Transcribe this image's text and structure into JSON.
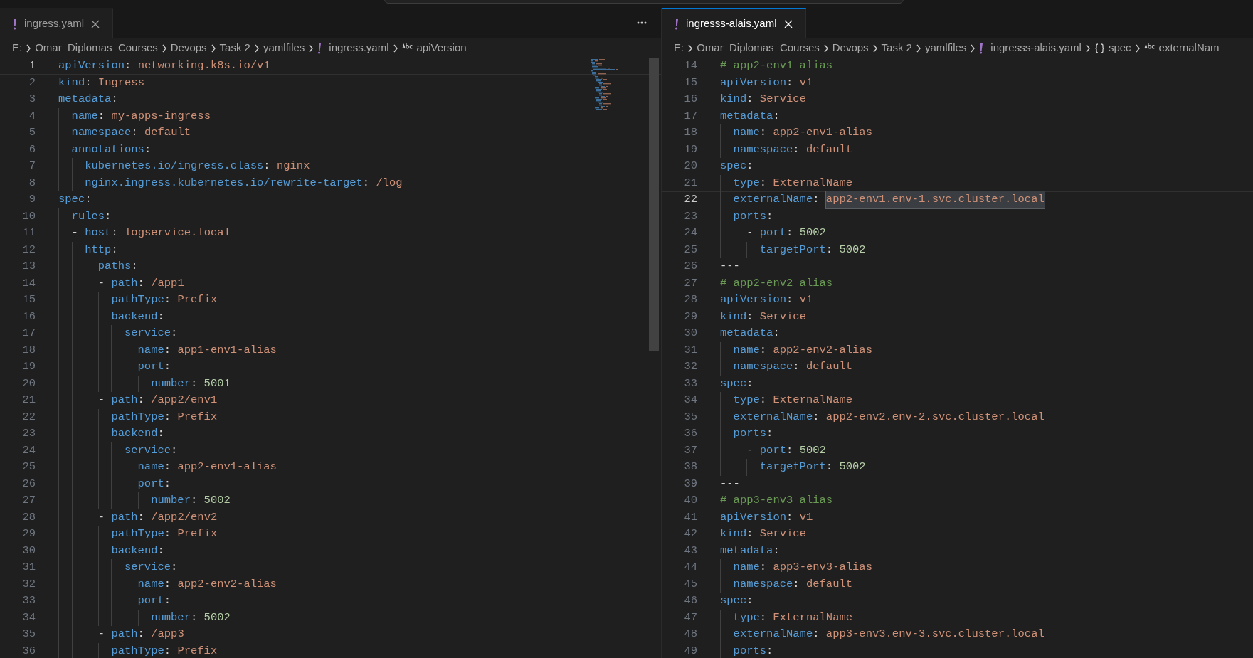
{
  "panes": [
    {
      "tabs": [
        {
          "label": "ingress.yaml",
          "selected": true
        }
      ],
      "group_active": false,
      "more_actions": true,
      "breadcrumbs": [
        {
          "kind": "text",
          "text": "E:"
        },
        {
          "kind": "text",
          "text": "Omar_Diplomas_Courses"
        },
        {
          "kind": "text",
          "text": "Devops"
        },
        {
          "kind": "text",
          "text": "Task 2"
        },
        {
          "kind": "text",
          "text": "yamlfiles"
        },
        {
          "kind": "file",
          "text": "ingress.yaml"
        },
        {
          "kind": "string",
          "text": "apiVersion"
        }
      ],
      "minimap": true,
      "lines": [
        {
          "number": "1",
          "current": true,
          "tokens": [
            {
              "kind": "key",
              "text": "apiVersion"
            },
            {
              "kind": "punct",
              "text": ": "
            },
            {
              "kind": "string",
              "text": "networking.k8s.io/v1"
            }
          ]
        },
        {
          "number": "2",
          "current": false,
          "tokens": [
            {
              "kind": "key",
              "text": "kind"
            },
            {
              "kind": "punct",
              "text": ": "
            },
            {
              "kind": "string",
              "text": "Ingress"
            }
          ]
        },
        {
          "number": "3",
          "current": false,
          "tokens": [
            {
              "kind": "key",
              "text": "metadata"
            },
            {
              "kind": "punct",
              "text": ":"
            }
          ]
        },
        {
          "number": "4",
          "current": false,
          "tokens": [
            {
              "kind": "key",
              "text": "  name"
            },
            {
              "kind": "punct",
              "text": ": "
            },
            {
              "kind": "string",
              "text": "my-apps-ingress"
            }
          ]
        },
        {
          "number": "5",
          "current": false,
          "tokens": [
            {
              "kind": "key",
              "text": "  namespace"
            },
            {
              "kind": "punct",
              "text": ": "
            },
            {
              "kind": "string",
              "text": "default"
            }
          ]
        },
        {
          "number": "6",
          "current": false,
          "tokens": [
            {
              "kind": "key",
              "text": "  annotations"
            },
            {
              "kind": "punct",
              "text": ":"
            }
          ]
        },
        {
          "number": "7",
          "current": false,
          "tokens": [
            {
              "kind": "key",
              "text": "    kubernetes.io/ingress.class"
            },
            {
              "kind": "punct",
              "text": ": "
            },
            {
              "kind": "string",
              "text": "nginx"
            }
          ]
        },
        {
          "number": "8",
          "current": false,
          "tokens": [
            {
              "kind": "key",
              "text": "    nginx.ingress.kubernetes.io/rewrite-target"
            },
            {
              "kind": "punct",
              "text": ": "
            },
            {
              "kind": "string",
              "text": "/log"
            }
          ]
        },
        {
          "number": "9",
          "current": false,
          "tokens": [
            {
              "kind": "key",
              "text": "spec"
            },
            {
              "kind": "punct",
              "text": ":"
            }
          ]
        },
        {
          "number": "10",
          "current": false,
          "tokens": [
            {
              "kind": "key",
              "text": "  rules"
            },
            {
              "kind": "punct",
              "text": ":"
            }
          ]
        },
        {
          "number": "11",
          "current": false,
          "tokens": [
            {
              "kind": "punct",
              "text": "  - "
            },
            {
              "kind": "key",
              "text": "host"
            },
            {
              "kind": "punct",
              "text": ": "
            },
            {
              "kind": "string",
              "text": "logservice.local"
            }
          ]
        },
        {
          "number": "12",
          "current": false,
          "tokens": [
            {
              "kind": "key",
              "text": "    http"
            },
            {
              "kind": "punct",
              "text": ":"
            }
          ]
        },
        {
          "number": "13",
          "current": false,
          "tokens": [
            {
              "kind": "key",
              "text": "      paths"
            },
            {
              "kind": "punct",
              "text": ":"
            }
          ]
        },
        {
          "number": "14",
          "current": false,
          "tokens": [
            {
              "kind": "punct",
              "text": "      - "
            },
            {
              "kind": "key",
              "text": "path"
            },
            {
              "kind": "punct",
              "text": ": "
            },
            {
              "kind": "string",
              "text": "/app1"
            }
          ]
        },
        {
          "number": "15",
          "current": false,
          "tokens": [
            {
              "kind": "key",
              "text": "        pathType"
            },
            {
              "kind": "punct",
              "text": ": "
            },
            {
              "kind": "string",
              "text": "Prefix"
            }
          ]
        },
        {
          "number": "16",
          "current": false,
          "tokens": [
            {
              "kind": "key",
              "text": "        backend"
            },
            {
              "kind": "punct",
              "text": ":"
            }
          ]
        },
        {
          "number": "17",
          "current": false,
          "tokens": [
            {
              "kind": "key",
              "text": "          service"
            },
            {
              "kind": "punct",
              "text": ":"
            }
          ]
        },
        {
          "number": "18",
          "current": false,
          "tokens": [
            {
              "kind": "key",
              "text": "            name"
            },
            {
              "kind": "punct",
              "text": ": "
            },
            {
              "kind": "string",
              "text": "app1-env1-alias"
            }
          ]
        },
        {
          "number": "19",
          "current": false,
          "tokens": [
            {
              "kind": "key",
              "text": "            port"
            },
            {
              "kind": "punct",
              "text": ":"
            }
          ]
        },
        {
          "number": "20",
          "current": false,
          "tokens": [
            {
              "kind": "key",
              "text": "              number"
            },
            {
              "kind": "punct",
              "text": ": "
            },
            {
              "kind": "number",
              "text": "5001"
            }
          ]
        },
        {
          "number": "21",
          "current": false,
          "tokens": [
            {
              "kind": "punct",
              "text": "      - "
            },
            {
              "kind": "key",
              "text": "path"
            },
            {
              "kind": "punct",
              "text": ": "
            },
            {
              "kind": "string",
              "text": "/app2/env1"
            }
          ]
        },
        {
          "number": "22",
          "current": false,
          "tokens": [
            {
              "kind": "key",
              "text": "        pathType"
            },
            {
              "kind": "punct",
              "text": ": "
            },
            {
              "kind": "string",
              "text": "Prefix"
            }
          ]
        },
        {
          "number": "23",
          "current": false,
          "tokens": [
            {
              "kind": "key",
              "text": "        backend"
            },
            {
              "kind": "punct",
              "text": ":"
            }
          ]
        },
        {
          "number": "24",
          "current": false,
          "tokens": [
            {
              "kind": "key",
              "text": "          service"
            },
            {
              "kind": "punct",
              "text": ":"
            }
          ]
        },
        {
          "number": "25",
          "current": false,
          "tokens": [
            {
              "kind": "key",
              "text": "            name"
            },
            {
              "kind": "punct",
              "text": ": "
            },
            {
              "kind": "string",
              "text": "app2-env1-alias"
            }
          ]
        },
        {
          "number": "26",
          "current": false,
          "tokens": [
            {
              "kind": "key",
              "text": "            port"
            },
            {
              "kind": "punct",
              "text": ":"
            }
          ]
        },
        {
          "number": "27",
          "current": false,
          "tokens": [
            {
              "kind": "key",
              "text": "              number"
            },
            {
              "kind": "punct",
              "text": ": "
            },
            {
              "kind": "number",
              "text": "5002"
            }
          ]
        },
        {
          "number": "28",
          "current": false,
          "tokens": [
            {
              "kind": "punct",
              "text": "      - "
            },
            {
              "kind": "key",
              "text": "path"
            },
            {
              "kind": "punct",
              "text": ": "
            },
            {
              "kind": "string",
              "text": "/app2/env2"
            }
          ]
        },
        {
          "number": "29",
          "current": false,
          "tokens": [
            {
              "kind": "key",
              "text": "        pathType"
            },
            {
              "kind": "punct",
              "text": ": "
            },
            {
              "kind": "string",
              "text": "Prefix"
            }
          ]
        },
        {
          "number": "30",
          "current": false,
          "tokens": [
            {
              "kind": "key",
              "text": "        backend"
            },
            {
              "kind": "punct",
              "text": ":"
            }
          ]
        },
        {
          "number": "31",
          "current": false,
          "tokens": [
            {
              "kind": "key",
              "text": "          service"
            },
            {
              "kind": "punct",
              "text": ":"
            }
          ]
        },
        {
          "number": "32",
          "current": false,
          "tokens": [
            {
              "kind": "key",
              "text": "            name"
            },
            {
              "kind": "punct",
              "text": ": "
            },
            {
              "kind": "string",
              "text": "app2-env2-alias"
            }
          ]
        },
        {
          "number": "33",
          "current": false,
          "tokens": [
            {
              "kind": "key",
              "text": "            port"
            },
            {
              "kind": "punct",
              "text": ":"
            }
          ]
        },
        {
          "number": "34",
          "current": false,
          "tokens": [
            {
              "kind": "key",
              "text": "              number"
            },
            {
              "kind": "punct",
              "text": ": "
            },
            {
              "kind": "number",
              "text": "5002"
            }
          ]
        },
        {
          "number": "35",
          "current": false,
          "tokens": [
            {
              "kind": "punct",
              "text": "      - "
            },
            {
              "kind": "key",
              "text": "path"
            },
            {
              "kind": "punct",
              "text": ": "
            },
            {
              "kind": "string",
              "text": "/app3"
            }
          ]
        },
        {
          "number": "36",
          "current": false,
          "tokens": [
            {
              "kind": "key",
              "text": "        pathType"
            },
            {
              "kind": "punct",
              "text": ": "
            },
            {
              "kind": "string",
              "text": "Prefix"
            }
          ]
        }
      ]
    },
    {
      "tabs": [
        {
          "label": "ingresss-alais.yaml",
          "selected": true
        }
      ],
      "group_active": true,
      "more_actions": false,
      "breadcrumbs": [
        {
          "kind": "text",
          "text": "E:"
        },
        {
          "kind": "text",
          "text": "Omar_Diplomas_Courses"
        },
        {
          "kind": "text",
          "text": "Devops"
        },
        {
          "kind": "text",
          "text": "Task 2"
        },
        {
          "kind": "text",
          "text": "yamlfiles"
        },
        {
          "kind": "file",
          "text": "ingresss-alais.yaml"
        },
        {
          "kind": "object",
          "text": "spec"
        },
        {
          "kind": "string",
          "text": "externalNam"
        }
      ],
      "minimap": false,
      "lines": [
        {
          "number": "14",
          "current": false,
          "tokens": [
            {
              "kind": "comment",
              "text": "# app2-env1 alias"
            }
          ]
        },
        {
          "number": "15",
          "current": false,
          "tokens": [
            {
              "kind": "key",
              "text": "apiVersion"
            },
            {
              "kind": "punct",
              "text": ": "
            },
            {
              "kind": "string",
              "text": "v1"
            }
          ]
        },
        {
          "number": "16",
          "current": false,
          "tokens": [
            {
              "kind": "key",
              "text": "kind"
            },
            {
              "kind": "punct",
              "text": ": "
            },
            {
              "kind": "string",
              "text": "Service"
            }
          ]
        },
        {
          "number": "17",
          "current": false,
          "tokens": [
            {
              "kind": "key",
              "text": "metadata"
            },
            {
              "kind": "punct",
              "text": ":"
            }
          ]
        },
        {
          "number": "18",
          "current": false,
          "tokens": [
            {
              "kind": "key",
              "text": "  name"
            },
            {
              "kind": "punct",
              "text": ": "
            },
            {
              "kind": "string",
              "text": "app2-env1-alias"
            }
          ]
        },
        {
          "number": "19",
          "current": false,
          "tokens": [
            {
              "kind": "key",
              "text": "  namespace"
            },
            {
              "kind": "punct",
              "text": ": "
            },
            {
              "kind": "string",
              "text": "default"
            }
          ]
        },
        {
          "number": "20",
          "current": false,
          "tokens": [
            {
              "kind": "key",
              "text": "spec"
            },
            {
              "kind": "punct",
              "text": ":"
            }
          ]
        },
        {
          "number": "21",
          "current": false,
          "tokens": [
            {
              "kind": "key",
              "text": "  type"
            },
            {
              "kind": "punct",
              "text": ": "
            },
            {
              "kind": "string",
              "text": "ExternalName"
            }
          ]
        },
        {
          "number": "22",
          "current": true,
          "tokens": [
            {
              "kind": "key",
              "text": "  externalName"
            },
            {
              "kind": "punct",
              "text": ": "
            },
            {
              "kind": "string",
              "text": "app2-env1.env-1.svc.cluster.local",
              "highlight": true
            }
          ]
        },
        {
          "number": "23",
          "current": false,
          "tokens": [
            {
              "kind": "key",
              "text": "  ports"
            },
            {
              "kind": "punct",
              "text": ":"
            }
          ]
        },
        {
          "number": "24",
          "current": false,
          "tokens": [
            {
              "kind": "punct",
              "text": "    - "
            },
            {
              "kind": "key",
              "text": "port"
            },
            {
              "kind": "punct",
              "text": ": "
            },
            {
              "kind": "number",
              "text": "5002"
            }
          ]
        },
        {
          "number": "25",
          "current": false,
          "tokens": [
            {
              "kind": "key",
              "text": "      targetPort"
            },
            {
              "kind": "punct",
              "text": ": "
            },
            {
              "kind": "number",
              "text": "5002"
            }
          ]
        },
        {
          "number": "26",
          "current": false,
          "tokens": [
            {
              "kind": "punct",
              "text": "---"
            }
          ]
        },
        {
          "number": "27",
          "current": false,
          "tokens": [
            {
              "kind": "comment",
              "text": "# app2-env2 alias"
            }
          ]
        },
        {
          "number": "28",
          "current": false,
          "tokens": [
            {
              "kind": "key",
              "text": "apiVersion"
            },
            {
              "kind": "punct",
              "text": ": "
            },
            {
              "kind": "string",
              "text": "v1"
            }
          ]
        },
        {
          "number": "29",
          "current": false,
          "tokens": [
            {
              "kind": "key",
              "text": "kind"
            },
            {
              "kind": "punct",
              "text": ": "
            },
            {
              "kind": "string",
              "text": "Service"
            }
          ]
        },
        {
          "number": "30",
          "current": false,
          "tokens": [
            {
              "kind": "key",
              "text": "metadata"
            },
            {
              "kind": "punct",
              "text": ":"
            }
          ]
        },
        {
          "number": "31",
          "current": false,
          "tokens": [
            {
              "kind": "key",
              "text": "  name"
            },
            {
              "kind": "punct",
              "text": ": "
            },
            {
              "kind": "string",
              "text": "app2-env2-alias"
            }
          ]
        },
        {
          "number": "32",
          "current": false,
          "tokens": [
            {
              "kind": "key",
              "text": "  namespace"
            },
            {
              "kind": "punct",
              "text": ": "
            },
            {
              "kind": "string",
              "text": "default"
            }
          ]
        },
        {
          "number": "33",
          "current": false,
          "tokens": [
            {
              "kind": "key",
              "text": "spec"
            },
            {
              "kind": "punct",
              "text": ":"
            }
          ]
        },
        {
          "number": "34",
          "current": false,
          "tokens": [
            {
              "kind": "key",
              "text": "  type"
            },
            {
              "kind": "punct",
              "text": ": "
            },
            {
              "kind": "string",
              "text": "ExternalName"
            }
          ]
        },
        {
          "number": "35",
          "current": false,
          "tokens": [
            {
              "kind": "key",
              "text": "  externalName"
            },
            {
              "kind": "punct",
              "text": ": "
            },
            {
              "kind": "string",
              "text": "app2-env2.env-2.svc.cluster.local"
            }
          ]
        },
        {
          "number": "36",
          "current": false,
          "tokens": [
            {
              "kind": "key",
              "text": "  ports"
            },
            {
              "kind": "punct",
              "text": ":"
            }
          ]
        },
        {
          "number": "37",
          "current": false,
          "tokens": [
            {
              "kind": "punct",
              "text": "    - "
            },
            {
              "kind": "key",
              "text": "port"
            },
            {
              "kind": "punct",
              "text": ": "
            },
            {
              "kind": "number",
              "text": "5002"
            }
          ]
        },
        {
          "number": "38",
          "current": false,
          "tokens": [
            {
              "kind": "key",
              "text": "      targetPort"
            },
            {
              "kind": "punct",
              "text": ": "
            },
            {
              "kind": "number",
              "text": "5002"
            }
          ]
        },
        {
          "number": "39",
          "current": false,
          "tokens": [
            {
              "kind": "punct",
              "text": "---"
            }
          ]
        },
        {
          "number": "40",
          "current": false,
          "tokens": [
            {
              "kind": "comment",
              "text": "# app3-env3 alias"
            }
          ]
        },
        {
          "number": "41",
          "current": false,
          "tokens": [
            {
              "kind": "key",
              "text": "apiVersion"
            },
            {
              "kind": "punct",
              "text": ": "
            },
            {
              "kind": "string",
              "text": "v1"
            }
          ]
        },
        {
          "number": "42",
          "current": false,
          "tokens": [
            {
              "kind": "key",
              "text": "kind"
            },
            {
              "kind": "punct",
              "text": ": "
            },
            {
              "kind": "string",
              "text": "Service"
            }
          ]
        },
        {
          "number": "43",
          "current": false,
          "tokens": [
            {
              "kind": "key",
              "text": "metadata"
            },
            {
              "kind": "punct",
              "text": ":"
            }
          ]
        },
        {
          "number": "44",
          "current": false,
          "tokens": [
            {
              "kind": "key",
              "text": "  name"
            },
            {
              "kind": "punct",
              "text": ": "
            },
            {
              "kind": "string",
              "text": "app3-env3-alias"
            }
          ]
        },
        {
          "number": "45",
          "current": false,
          "tokens": [
            {
              "kind": "key",
              "text": "  namespace"
            },
            {
              "kind": "punct",
              "text": ": "
            },
            {
              "kind": "string",
              "text": "default"
            }
          ]
        },
        {
          "number": "46",
          "current": false,
          "tokens": [
            {
              "kind": "key",
              "text": "spec"
            },
            {
              "kind": "punct",
              "text": ":"
            }
          ]
        },
        {
          "number": "47",
          "current": false,
          "tokens": [
            {
              "kind": "key",
              "text": "  type"
            },
            {
              "kind": "punct",
              "text": ": "
            },
            {
              "kind": "string",
              "text": "ExternalName"
            }
          ]
        },
        {
          "number": "48",
          "current": false,
          "tokens": [
            {
              "kind": "key",
              "text": "  externalName"
            },
            {
              "kind": "punct",
              "text": ": "
            },
            {
              "kind": "string",
              "text": "app3-env3.env-3.svc.cluster.local"
            }
          ]
        },
        {
          "number": "49",
          "current": false,
          "tokens": [
            {
              "kind": "key",
              "text": "  ports"
            },
            {
              "kind": "punct",
              "text": ":"
            }
          ]
        }
      ]
    }
  ]
}
